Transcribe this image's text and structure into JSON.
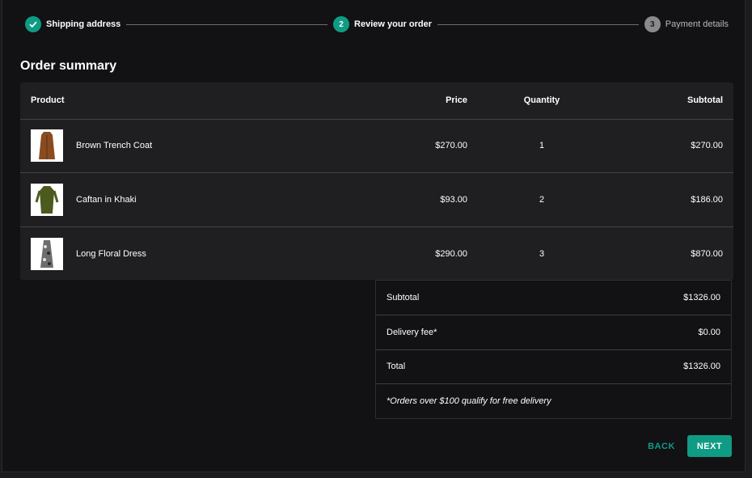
{
  "stepper": {
    "steps": [
      {
        "label": "Shipping address",
        "status": "done",
        "number": "1"
      },
      {
        "label": "Review your order",
        "status": "active",
        "number": "2"
      },
      {
        "label": "Payment details",
        "status": "todo",
        "number": "3"
      }
    ]
  },
  "page_title": "Order summary",
  "table": {
    "headers": {
      "product": "Product",
      "price": "Price",
      "quantity": "Quantity",
      "subtotal": "Subtotal"
    },
    "rows": [
      {
        "name": "Brown Trench Coat",
        "price": "$270.00",
        "quantity": "1",
        "subtotal": "$270.00",
        "image": "brown-trench-coat",
        "color": "#8a4b21"
      },
      {
        "name": "Caftan in Khaki",
        "price": "$93.00",
        "quantity": "2",
        "subtotal": "$186.00",
        "image": "khaki-caftan",
        "color": "#4b5a1f"
      },
      {
        "name": "Long Floral Dress",
        "price": "$290.00",
        "quantity": "3",
        "subtotal": "$870.00",
        "image": "floral-dress",
        "color": "#6d6d70"
      }
    ]
  },
  "summary": {
    "subtotal_label": "Subtotal",
    "subtotal_value": "$1326.00",
    "delivery_label": "Delivery fee*",
    "delivery_value": "$0.00",
    "total_label": "Total",
    "total_value": "$1326.00",
    "note": "*Orders over $100 qualify for free delivery"
  },
  "buttons": {
    "back": "BACK",
    "next": "NEXT"
  },
  "colors": {
    "accent": "#0f9b84",
    "background": "#121113",
    "table_bg": "#1f1e21"
  }
}
